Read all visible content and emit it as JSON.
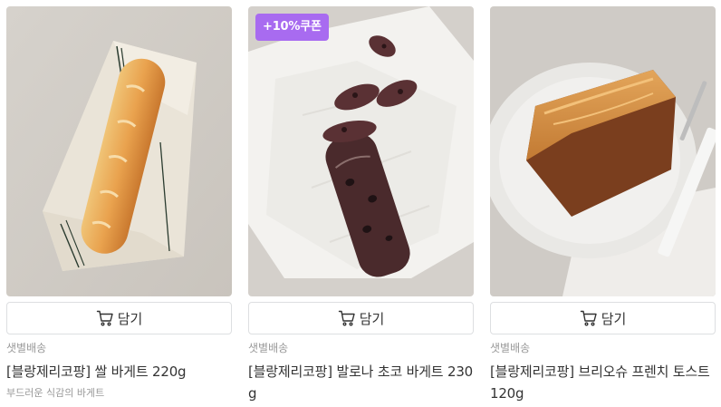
{
  "products": [
    {
      "image_alt": "쌀 바게트 이미지",
      "coupon": "",
      "cart_label": "담기",
      "delivery": "샛별배송",
      "name": "[블랑제리코팡] 쌀 바게트 220g",
      "description": "부드러운 식감의 바게트"
    },
    {
      "image_alt": "발로나 초코 바게트 이미지",
      "coupon": "+10%쿠폰",
      "cart_label": "담기",
      "delivery": "샛별배송",
      "name": "[블랑제리코팡] 발로나 초코 바게트 230g",
      "description": ""
    },
    {
      "image_alt": "브리오슈 프렌치 토스트 이미지",
      "coupon": "",
      "cart_label": "담기",
      "delivery": "샛별배송",
      "name": "[블랑제리코팡] 브리오슈 프렌치 토스트 120g",
      "description": ""
    }
  ],
  "icons": {
    "cart": "cart-icon"
  },
  "colors": {
    "coupon_badge": "#a86bf0",
    "muted_text": "#999999",
    "button_border": "#dddfe1"
  }
}
